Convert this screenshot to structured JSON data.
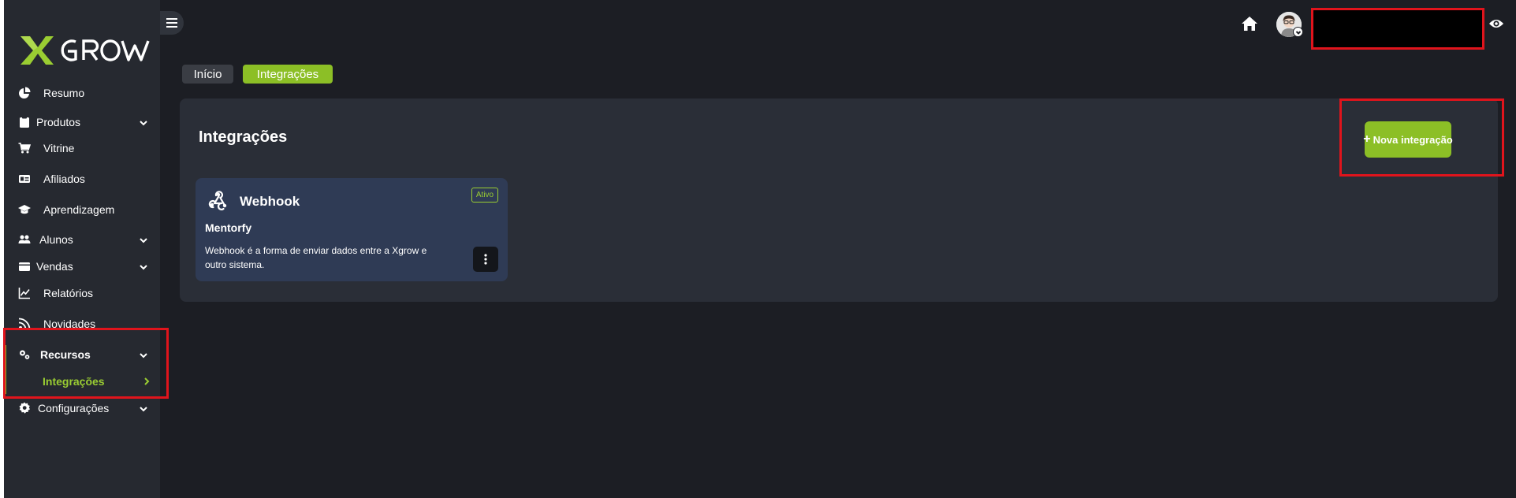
{
  "brand": {
    "logo_text": "XGROW",
    "accent_color": "#8cbf26",
    "logo_colors": {
      "x": "#9acd32",
      "text": "#ffffff"
    }
  },
  "sidebar": {
    "items": [
      {
        "label": "Resumo",
        "icon": "pie-chart-icon",
        "has_chevron": false
      },
      {
        "label": "Produtos",
        "icon": "box-icon",
        "has_chevron": true
      },
      {
        "label": "Vitrine",
        "icon": "cart-icon",
        "has_chevron": false
      },
      {
        "label": "Afiliados",
        "icon": "id-card-icon",
        "has_chevron": false
      },
      {
        "label": "Aprendizagem",
        "icon": "graduation-cap-icon",
        "has_chevron": false
      },
      {
        "label": "Alunos",
        "icon": "users-icon",
        "has_chevron": true
      },
      {
        "label": "Vendas",
        "icon": "wallet-icon",
        "has_chevron": true
      },
      {
        "label": "Relatórios",
        "icon": "line-chart-icon",
        "has_chevron": false
      },
      {
        "label": "Novidades",
        "icon": "rss-icon",
        "has_chevron": false
      },
      {
        "label": "Recursos",
        "icon": "gears-icon",
        "has_chevron": true,
        "expanded": true
      },
      {
        "label": "Configurações",
        "icon": "gear-icon",
        "has_chevron": true
      }
    ],
    "sub_items": [
      {
        "label": "Integrações",
        "parent": "Recursos",
        "active": true,
        "icon": "chevron-right-icon"
      }
    ]
  },
  "topbar": {
    "menu_icon": "hamburger-icon",
    "home_icon": "home-icon",
    "avatar_icon": "avatar-icon",
    "visibility_icon": "eye-icon"
  },
  "breadcrumb": {
    "items": [
      "Início",
      "Integrações"
    ],
    "active_color": "#8cbf26"
  },
  "main": {
    "title": "Integrações",
    "new_button_label": "Nova integração",
    "new_button_icon": "plus-icon"
  },
  "integrations": [
    {
      "type": "Webhook",
      "icon": "webhook-icon",
      "status": "Ativo",
      "name": "Mentorfy",
      "description": "Webhook é a forma de enviar dados entre a Xgrow e outro sistema.",
      "menu_icon": "kebab-menu-icon"
    }
  ],
  "annotations": {
    "highlight_color": "#e0141c"
  }
}
